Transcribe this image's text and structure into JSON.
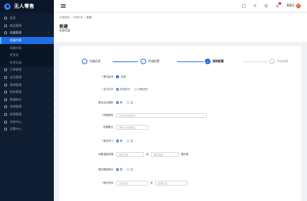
{
  "brand": {
    "name": "无人零售"
  },
  "sidebar": {
    "items": [
      {
        "label": "首页",
        "icon": "home-icon",
        "chevron": ""
      },
      {
        "label": "商品管理",
        "icon": "goods-icon",
        "chevron": "⌄"
      },
      {
        "label": "机器管理",
        "icon": "machine-icon",
        "chevron": "⌃"
      },
      {
        "label": "机器列表",
        "icon": "",
        "chevron": ""
      },
      {
        "label": "机器分组",
        "icon": "",
        "chevron": ""
      },
      {
        "label": "补货员",
        "icon": "",
        "chevron": ""
      },
      {
        "label": "补货记录",
        "icon": "",
        "chevron": ""
      },
      {
        "label": "订单管理",
        "icon": "order-icon",
        "chevron": "⌄"
      },
      {
        "label": "会员管理",
        "icon": "member-icon",
        "chevron": "⌄"
      },
      {
        "label": "营销管理",
        "icon": "marketing-icon",
        "chevron": "⌄"
      },
      {
        "label": "财务管理",
        "icon": "finance-icon",
        "chevron": "⌄"
      },
      {
        "label": "数据统计",
        "icon": "stats-icon",
        "chevron": "⌄"
      },
      {
        "label": "系统管理",
        "icon": "system-icon",
        "chevron": "⌄"
      },
      {
        "label": "权限管理",
        "icon": "permission-icon",
        "chevron": "⌄"
      },
      {
        "label": "消息中心",
        "icon": "message-icon",
        "chevron": "⌄"
      },
      {
        "label": "设置中心",
        "icon": "settings-icon",
        "chevron": "⌄"
      }
    ]
  },
  "header": {
    "notification_count": "1",
    "user_name": "管理员"
  },
  "breadcrumb": [
    "机器管理",
    "机器列表",
    "新建"
  ],
  "page": {
    "title": "新建",
    "subtitle": "新建机器"
  },
  "steps": [
    {
      "label": "机器信息",
      "mark": "✓",
      "state": "done"
    },
    {
      "label": "货道配置",
      "mark": "✓",
      "state": "done"
    },
    {
      "label": "规则配置",
      "mark": "3",
      "state": "active"
    },
    {
      "label": "完成创建",
      "mark": "4",
      "state": "wait"
    }
  ],
  "form": {
    "enable": {
      "label": "是否启用",
      "option": "启用"
    },
    "pay_mode": {
      "label": "支付方式",
      "options": [
        "在线支付",
        "扫码支付"
      ]
    },
    "auto_refund": {
      "label": "是否自动退款",
      "options": [
        "是",
        "否"
      ]
    },
    "machine_type": {
      "label": "机器类型",
      "placeholder": "请选择机器类型"
    },
    "remark": {
      "label": "机器备注",
      "placeholder": "请输入机器备注"
    },
    "open_door": {
      "label": "是否开门",
      "options": [
        "是",
        "否"
      ]
    },
    "temp_range": {
      "label": "设置温度范围",
      "min_placeholder": "最低温度",
      "to": "至",
      "max_placeholder": "最高温度",
      "unit": "摄氏度"
    },
    "sale_limit": {
      "label": "是否限制购买",
      "options": [
        "是",
        "否"
      ]
    },
    "business_time": {
      "label": "营业时间",
      "start_placeholder": "开始时间",
      "end_placeholder": "结束时间",
      "to": "至"
    }
  }
}
